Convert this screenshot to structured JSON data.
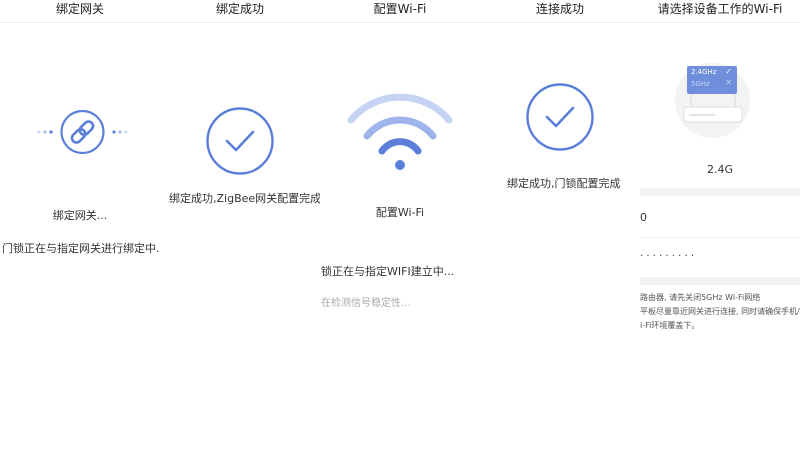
{
  "panels": [
    {
      "title": "绑定网关",
      "status": "绑定网关...",
      "detail": "门锁正在与指定网关进行绑定中..."
    },
    {
      "title": "绑定成功",
      "message": "绑定成功,ZigBee网关配置完成"
    },
    {
      "title": "配置Wi-Fi",
      "status": "配置Wi-Fi",
      "detail": "锁正在与指定WIFI建立中...",
      "hint": "在检测信号稳定性..."
    },
    {
      "title": "连接成功",
      "message": "绑定成功,门锁配置完成"
    },
    {
      "title": "请选择设备工作的Wi-Fi",
      "router_badge_24": "2.4GHz",
      "router_badge_5": "5GHz",
      "band": "2.4G",
      "ssid_value": "0",
      "password_mask": "· · · · · · · · ·",
      "notes": [
        "路由器, 请先关闭5GHz Wi-Fi网络",
        "平板尽量靠近网关进行连接, 同时请确保手机/平",
        "i-Fi环境覆盖下。"
      ]
    }
  ],
  "colors": {
    "accent": "#5b7fd9",
    "accent_light": "#c7d3f3",
    "divider": "#f2f2f2"
  }
}
